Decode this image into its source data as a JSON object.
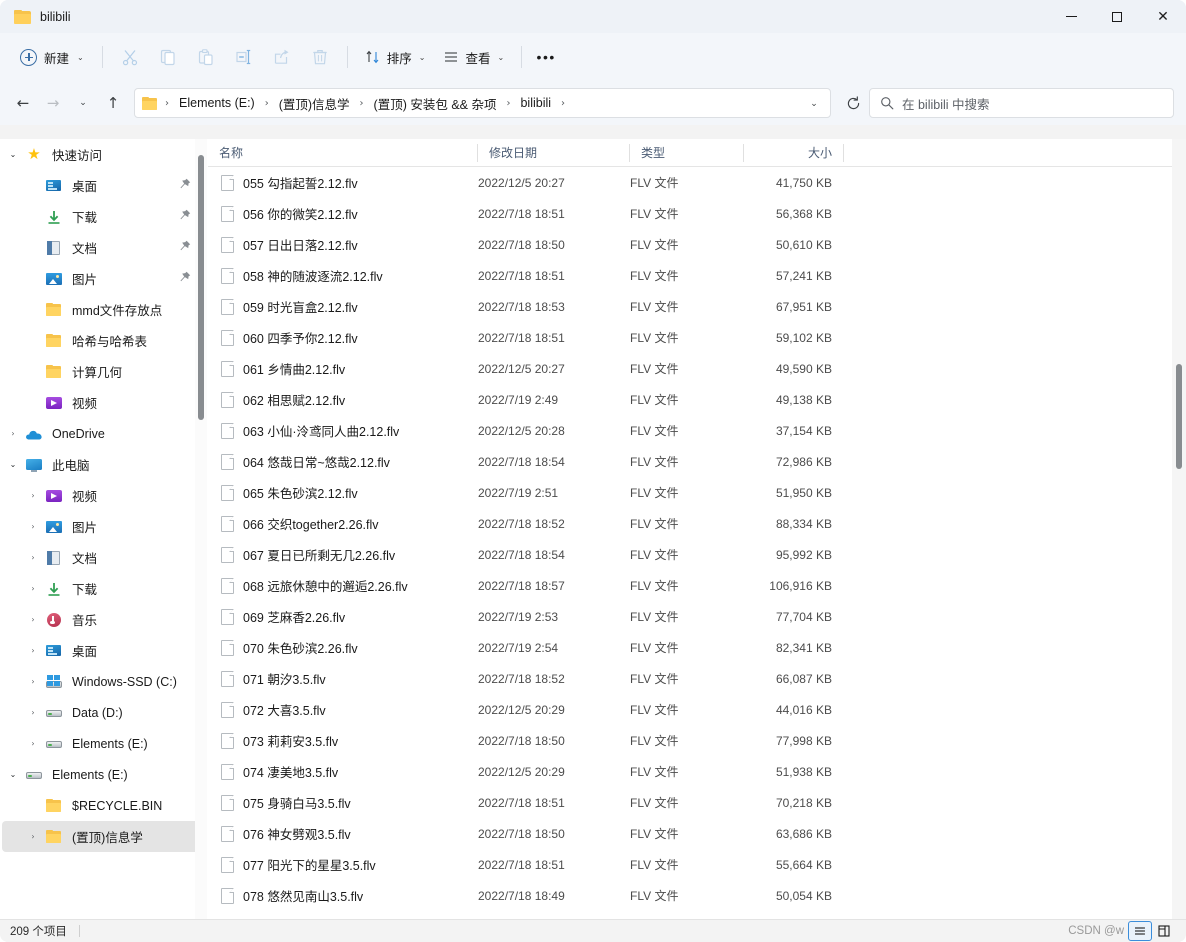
{
  "window": {
    "title": "bilibili",
    "folder_icon": "folder-icon",
    "minimize": "—",
    "maximize": "□",
    "close": "✕"
  },
  "toolbar": {
    "new_label": "新建",
    "new_caret": "⌄",
    "cut_icon": "scissors-icon",
    "copy_icon": "copy-icon",
    "paste_icon": "paste-icon",
    "rename_icon": "rename-icon",
    "share_icon": "share-icon",
    "delete_icon": "trash-icon",
    "sort_label": "排序",
    "sort_caret": "⌄",
    "view_label": "查看",
    "view_caret": "⌄",
    "more_label": "•••"
  },
  "addressbar": {
    "back_icon": "←",
    "forward_icon": "→",
    "recent_caret": "⌄",
    "up_icon": "↑",
    "breadcrumb": [
      "Elements (E:)",
      "(置顶)信息学",
      "(置顶) 安装包 && 杂项",
      "bilibili"
    ],
    "separator": "›",
    "dropdown_caret": "⌄",
    "refresh_icon": "refresh-icon",
    "search_placeholder": "在 bilibili 中搜索"
  },
  "sidebar": {
    "items": [
      {
        "label": "快速访问",
        "icon": "star-icon",
        "arrow": "open",
        "indent": 0,
        "pin": false,
        "selected": false
      },
      {
        "label": "桌面",
        "icon": "desktop-icon",
        "arrow": "none",
        "indent": 1,
        "pin": true,
        "selected": false
      },
      {
        "label": "下载",
        "icon": "download-icon",
        "arrow": "none",
        "indent": 1,
        "pin": true,
        "selected": false
      },
      {
        "label": "文档",
        "icon": "document-icon",
        "arrow": "none",
        "indent": 1,
        "pin": true,
        "selected": false
      },
      {
        "label": "图片",
        "icon": "pictures-icon",
        "arrow": "none",
        "indent": 1,
        "pin": true,
        "selected": false
      },
      {
        "label": "mmd文件存放点",
        "icon": "folder-icon",
        "arrow": "none",
        "indent": 1,
        "pin": false,
        "selected": false
      },
      {
        "label": "哈希与哈希表",
        "icon": "folder-icon",
        "arrow": "none",
        "indent": 1,
        "pin": false,
        "selected": false
      },
      {
        "label": "计算几何",
        "icon": "folder-icon",
        "arrow": "none",
        "indent": 1,
        "pin": false,
        "selected": false
      },
      {
        "label": "视频",
        "icon": "video-icon",
        "arrow": "none",
        "indent": 1,
        "pin": false,
        "selected": false
      },
      {
        "label": "OneDrive",
        "icon": "cloud-icon",
        "arrow": "closed",
        "indent": 0,
        "pin": false,
        "selected": false
      },
      {
        "label": "此电脑",
        "icon": "pc-icon",
        "arrow": "open",
        "indent": 0,
        "pin": false,
        "selected": false
      },
      {
        "label": "视频",
        "icon": "video-icon",
        "arrow": "closed",
        "indent": 1,
        "pin": false,
        "selected": false
      },
      {
        "label": "图片",
        "icon": "pictures-icon",
        "arrow": "closed",
        "indent": 1,
        "pin": false,
        "selected": false
      },
      {
        "label": "文档",
        "icon": "document-icon",
        "arrow": "closed",
        "indent": 1,
        "pin": false,
        "selected": false
      },
      {
        "label": "下载",
        "icon": "download-icon",
        "arrow": "closed",
        "indent": 1,
        "pin": false,
        "selected": false
      },
      {
        "label": "音乐",
        "icon": "music-icon",
        "arrow": "closed",
        "indent": 1,
        "pin": false,
        "selected": false
      },
      {
        "label": "桌面",
        "icon": "desktop-icon",
        "arrow": "closed",
        "indent": 1,
        "pin": false,
        "selected": false
      },
      {
        "label": "Windows-SSD (C:)",
        "icon": "windows-drive-icon",
        "arrow": "closed",
        "indent": 1,
        "pin": false,
        "selected": false
      },
      {
        "label": "Data (D:)",
        "icon": "drive-icon",
        "arrow": "closed",
        "indent": 1,
        "pin": false,
        "selected": false
      },
      {
        "label": "Elements (E:)",
        "icon": "drive-icon",
        "arrow": "closed",
        "indent": 1,
        "pin": false,
        "selected": false
      },
      {
        "label": "Elements (E:)",
        "icon": "drive-icon",
        "arrow": "open",
        "indent": 0,
        "pin": false,
        "selected": false
      },
      {
        "label": "$RECYCLE.BIN",
        "icon": "folder-icon",
        "arrow": "none",
        "indent": 1,
        "pin": false,
        "selected": false
      },
      {
        "label": "(置顶)信息学",
        "icon": "folder-icon",
        "arrow": "closed",
        "indent": 1,
        "pin": false,
        "selected": true
      }
    ]
  },
  "filelist": {
    "columns": [
      {
        "key": "name",
        "label": "名称",
        "sorted": "asc"
      },
      {
        "key": "date",
        "label": "修改日期",
        "sorted": ""
      },
      {
        "key": "type",
        "label": "类型",
        "sorted": ""
      },
      {
        "key": "size",
        "label": "大小",
        "sorted": ""
      }
    ],
    "sort_indicator": "⌃",
    "rows": [
      {
        "name": "055 勾指起誓2.12.flv",
        "date": "2022/12/5 20:27",
        "type": "FLV 文件",
        "size": "41,750 KB"
      },
      {
        "name": "056 你的微笑2.12.flv",
        "date": "2022/7/18 18:51",
        "type": "FLV 文件",
        "size": "56,368 KB"
      },
      {
        "name": "057 日出日落2.12.flv",
        "date": "2022/7/18 18:50",
        "type": "FLV 文件",
        "size": "50,610 KB"
      },
      {
        "name": "058 神的随波逐流2.12.flv",
        "date": "2022/7/18 18:51",
        "type": "FLV 文件",
        "size": "57,241 KB"
      },
      {
        "name": "059 时光盲盒2.12.flv",
        "date": "2022/7/18 18:53",
        "type": "FLV 文件",
        "size": "67,951 KB"
      },
      {
        "name": "060 四季予你2.12.flv",
        "date": "2022/7/18 18:51",
        "type": "FLV 文件",
        "size": "59,102 KB"
      },
      {
        "name": "061 乡情曲2.12.flv",
        "date": "2022/12/5 20:27",
        "type": "FLV 文件",
        "size": "49,590 KB"
      },
      {
        "name": "062 相思赋2.12.flv",
        "date": "2022/7/19 2:49",
        "type": "FLV 文件",
        "size": "49,138 KB"
      },
      {
        "name": "063 小仙·泠鸢同人曲2.12.flv",
        "date": "2022/12/5 20:28",
        "type": "FLV 文件",
        "size": "37,154 KB"
      },
      {
        "name": "064 悠哉日常~悠哉2.12.flv",
        "date": "2022/7/18 18:54",
        "type": "FLV 文件",
        "size": "72,986 KB"
      },
      {
        "name": "065 朱色砂滨2.12.flv",
        "date": "2022/7/19 2:51",
        "type": "FLV 文件",
        "size": "51,950 KB"
      },
      {
        "name": "066 交织together2.26.flv",
        "date": "2022/7/18 18:52",
        "type": "FLV 文件",
        "size": "88,334 KB"
      },
      {
        "name": "067 夏日已所剩无几2.26.flv",
        "date": "2022/7/18 18:54",
        "type": "FLV 文件",
        "size": "95,992 KB"
      },
      {
        "name": "068 远旅休憩中的邂逅2.26.flv",
        "date": "2022/7/18 18:57",
        "type": "FLV 文件",
        "size": "106,916 KB"
      },
      {
        "name": "069 芝麻香2.26.flv",
        "date": "2022/7/19 2:53",
        "type": "FLV 文件",
        "size": "77,704 KB"
      },
      {
        "name": "070 朱色砂滨2.26.flv",
        "date": "2022/7/19 2:54",
        "type": "FLV 文件",
        "size": "82,341 KB"
      },
      {
        "name": "071 朝汐3.5.flv",
        "date": "2022/7/18 18:52",
        "type": "FLV 文件",
        "size": "66,087 KB"
      },
      {
        "name": "072 大喜3.5.flv",
        "date": "2022/12/5 20:29",
        "type": "FLV 文件",
        "size": "44,016 KB"
      },
      {
        "name": "073 莉莉安3.5.flv",
        "date": "2022/7/18 18:50",
        "type": "FLV 文件",
        "size": "77,998 KB"
      },
      {
        "name": "074 凄美地3.5.flv",
        "date": "2022/12/5 20:29",
        "type": "FLV 文件",
        "size": "51,938 KB"
      },
      {
        "name": "075 身骑白马3.5.flv",
        "date": "2022/7/18 18:51",
        "type": "FLV 文件",
        "size": "70,218 KB"
      },
      {
        "name": "076 神女劈观3.5.flv",
        "date": "2022/7/18 18:50",
        "type": "FLV 文件",
        "size": "63,686 KB"
      },
      {
        "name": "077 阳光下的星星3.5.flv",
        "date": "2022/7/18 18:51",
        "type": "FLV 文件",
        "size": "55,664 KB"
      },
      {
        "name": "078 悠然见南山3.5.flv",
        "date": "2022/7/18 18:49",
        "type": "FLV 文件",
        "size": "50,054 KB"
      }
    ]
  },
  "statusbar": {
    "item_count": "209 个项目",
    "watermark": "CSDN @w",
    "details_view_icon": "details-view-icon",
    "large_icons_view_icon": "large-icons-view-icon"
  },
  "colors": {
    "accent": "#3a8ddb",
    "folder_yellow": "#ffd05b",
    "titlebar_bg": "#eef2f7",
    "selection_gray": "#e4e4e4"
  }
}
